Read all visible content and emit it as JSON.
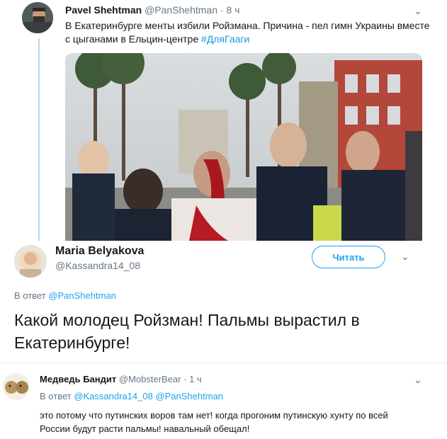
{
  "tweet1": {
    "name": "Pavel Shehtman",
    "handle": "@PanShehtman",
    "time": "· 8 ч",
    "text_main": "В Екатеринбурге менты избили Ройзмана. Причина - пел гимн Украины вместе с цыганами в Ельцин-центре ",
    "hashtag": "#ДляГааги",
    "menu_icon": "chevron-down-icon"
  },
  "tweet2": {
    "name": "Maria Belyakova",
    "handle": "@Kassandra14_08",
    "follow_label": "Читать",
    "reply_prefix": "В ответ ",
    "reply_handle": "@PanShehtman",
    "text": "Какой молодец Ройзман! Пальмы вырастил в Екатеринбурге!",
    "menu_icon": "chevron-down-icon"
  },
  "tweet3": {
    "name": "Медведь Бандит",
    "handle": "@MobsterBear",
    "time": "· 1 ч",
    "reply_prefix": "В ответ ",
    "reply_handle1": "@Kassandra14_08",
    "reply_handle2": "@PanShehtman",
    "text": "это потому что путинских воров там нет! когда прогоним путинскую хунту по всей России будут расти пальмы! навальный обещал!",
    "menu_icon": "chevron-down-icon"
  },
  "colors": {
    "link": "#1da1f2",
    "muted": "#657786",
    "thread_line": "#b7d8ee"
  }
}
